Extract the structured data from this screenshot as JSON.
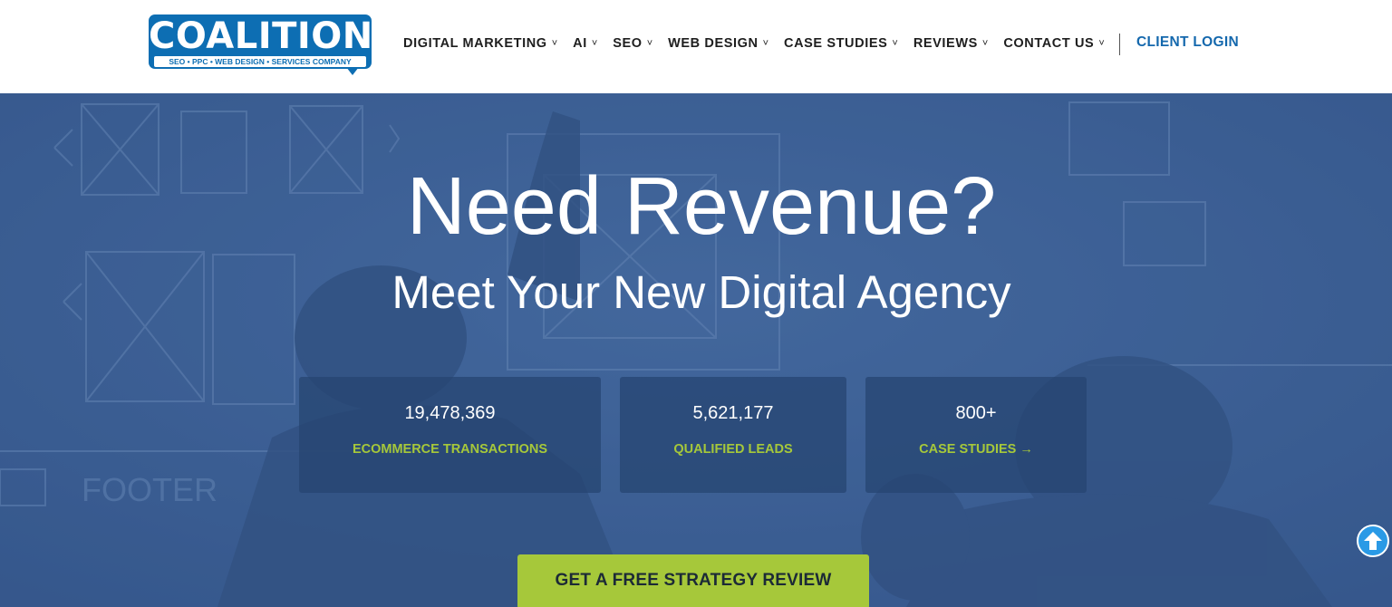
{
  "header": {
    "logo": {
      "wordmark": "COALITION",
      "tagline": "SEO • PPC • WEB DESIGN • SERVICES COMPANY"
    },
    "nav": [
      {
        "label": "DIGITAL MARKETING",
        "caret": "˅"
      },
      {
        "label": "AI",
        "caret": "˅"
      },
      {
        "label": "SEO",
        "caret": "˅"
      },
      {
        "label": "WEB DESIGN",
        "caret": "˅"
      },
      {
        "label": "CASE STUDIES",
        "caret": "˅"
      },
      {
        "label": "REVIEWS",
        "caret": "˅"
      },
      {
        "label": "CONTACT US",
        "caret": "˅"
      }
    ],
    "client_login": "CLIENT LOGIN"
  },
  "hero": {
    "title": "Need Revenue?",
    "subtitle": "Meet Your New Digital Agency",
    "stats": [
      {
        "value": "19,478,369",
        "label": "ECOMMERCE TRANSACTIONS"
      },
      {
        "value": "5,621,177",
        "label": "QUALIFIED LEADS"
      },
      {
        "value": "800+",
        "label": "CASE STUDIES →"
      }
    ],
    "cta": "GET A FREE STRATEGY REVIEW"
  },
  "colors": {
    "brand_blue": "#0d6eb3",
    "client_login_blue": "#1468ad",
    "hero_overlay": "#3d5f93",
    "accent_green": "#a6c83a",
    "scroll_button": "#2a9ae6"
  },
  "icons": {
    "nav_caret": "chevron-down-icon",
    "scroll_top": "arrow-up-circle-icon"
  }
}
